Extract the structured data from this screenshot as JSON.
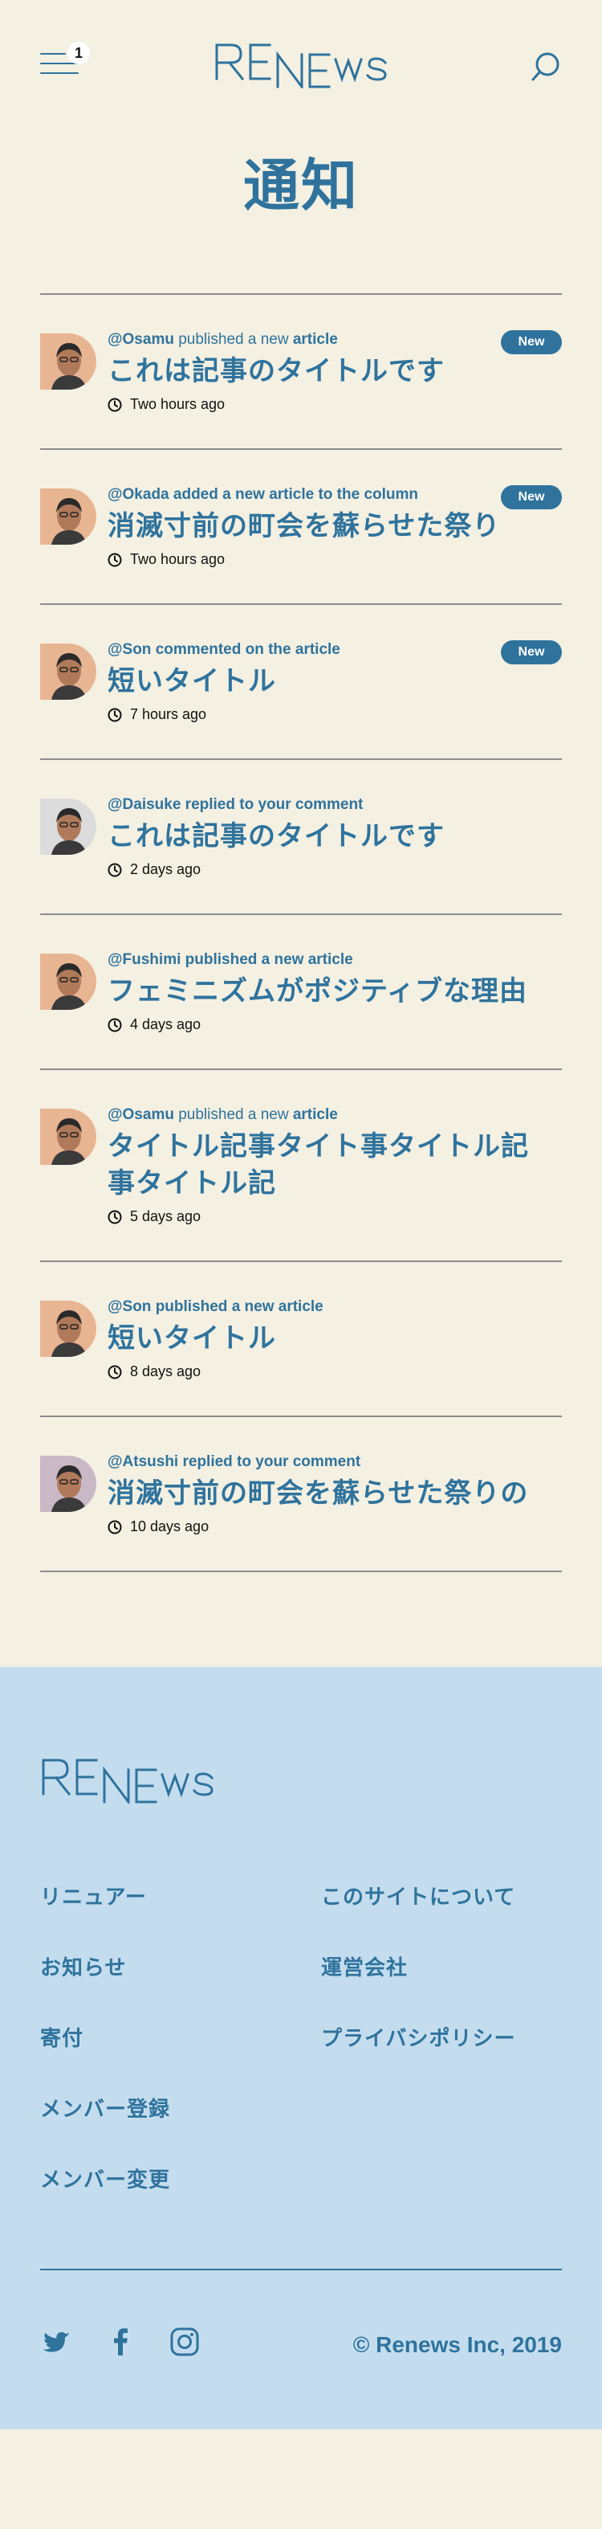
{
  "header": {
    "menu_badge": "1",
    "logo_text": "RENEWS",
    "icons": {
      "menu": "hamburger-icon",
      "search": "search-icon"
    }
  },
  "page_title": "通知",
  "notifications": [
    {
      "user": "@Osamu",
      "action": " published a new ",
      "object": "article",
      "style": "mixed",
      "title": "これは記事のタイトルです",
      "time": "Two hours ago",
      "badge": "New"
    },
    {
      "user": "@Okada added a new article to the column",
      "action": "",
      "object": "",
      "style": "bold",
      "title": "消滅寸前の町会を蘇らせた祭り",
      "time": "Two hours ago",
      "badge": "New"
    },
    {
      "user": "@Son commented on the article",
      "action": "",
      "object": "",
      "style": "bold",
      "title": "短いタイトル",
      "time": "7 hours ago",
      "badge": "New"
    },
    {
      "user": "@Daisuke replied to your comment",
      "action": "",
      "object": "",
      "style": "bold",
      "title": "これは記事のタイトルです",
      "time": "2 days ago",
      "badge": ""
    },
    {
      "user": "@Fushimi published a new article",
      "action": "",
      "object": "",
      "style": "bold",
      "title": "フェミニズムがポジティブな理由",
      "time": "4 days ago",
      "badge": ""
    },
    {
      "user": "@Osamu",
      "action": " published a new ",
      "object": "article",
      "style": "mixed",
      "title": "タイトル記事タイト事タイトル記事タイトル記",
      "time": "5 days ago",
      "badge": ""
    },
    {
      "user": "@Son published a new article",
      "action": "",
      "object": "",
      "style": "bold",
      "title": "短いタイトル",
      "time": "8 days ago",
      "badge": ""
    },
    {
      "user": "@Atsushi replied to your comment",
      "action": "",
      "object": "",
      "style": "bold",
      "title": "消滅寸前の町会を蘇らせた祭りの",
      "time": "10 days ago",
      "badge": ""
    }
  ],
  "footer": {
    "logo_text": "RENEWS",
    "nav_left": [
      "リニュアー",
      "お知らせ",
      "寄付",
      "メンバー登録",
      "メンバー変更"
    ],
    "nav_right": [
      "このサイトについて",
      "運営会社",
      "プライバシポリシー"
    ],
    "social": [
      "twitter-icon",
      "facebook-icon",
      "instagram-icon"
    ],
    "copyright": "© Renews Inc, 2019"
  },
  "colors": {
    "background": "#f4f0e2",
    "accent": "#2f739d",
    "footer": "#c4ddee",
    "divider": "#8c8c8c",
    "avatar_bg": "#e8b592"
  }
}
